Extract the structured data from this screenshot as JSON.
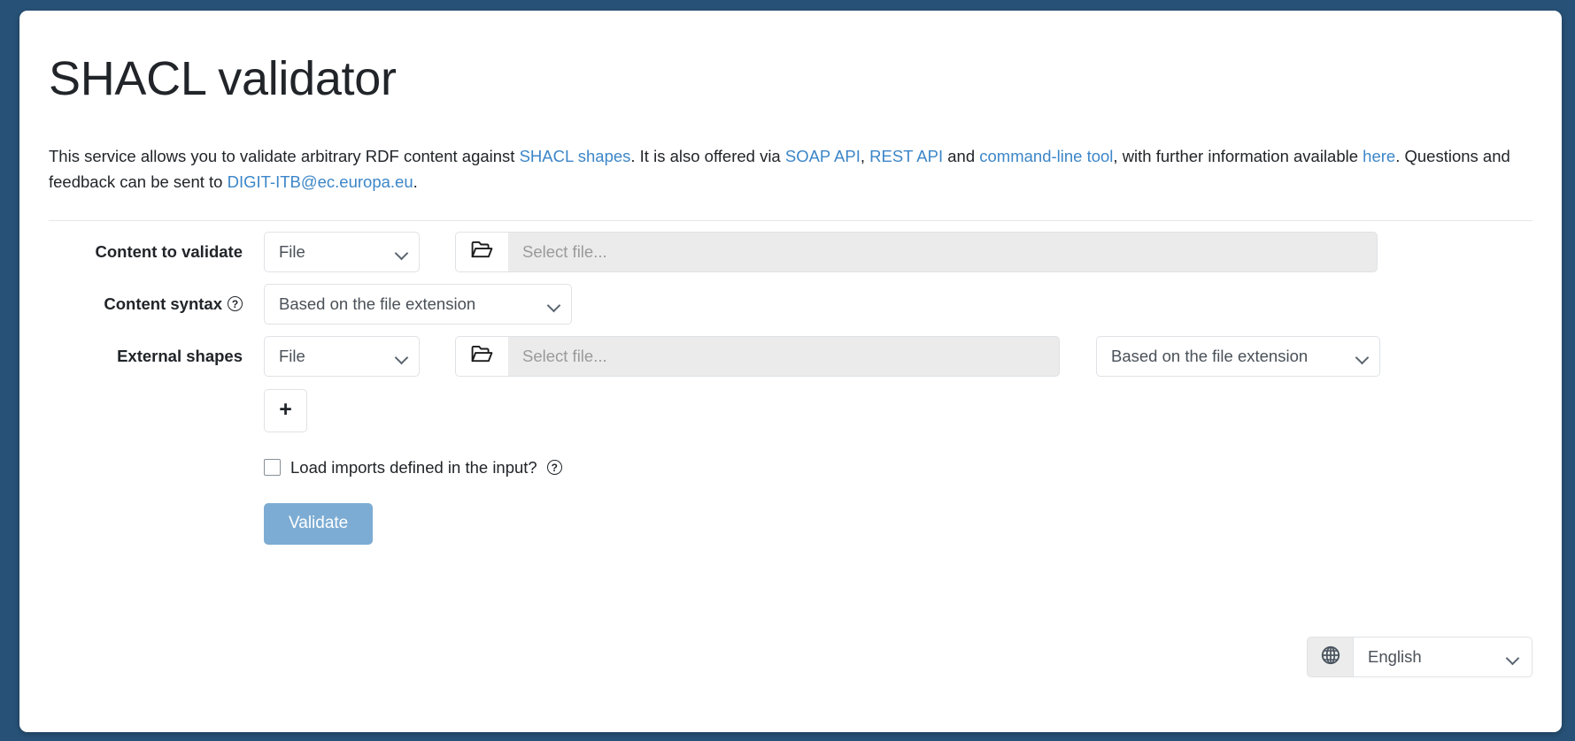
{
  "page": {
    "title": "SHACL validator",
    "background_color": "#275176",
    "card_color": "#ffffff",
    "link_color": "#3c86c8"
  },
  "intro": {
    "part1": "This service allows you to validate arbitrary RDF content against ",
    "link_shacl_shapes": "SHACL shapes",
    "part2": ". It is also offered via ",
    "link_soap_api": "SOAP API",
    "part3": ", ",
    "link_rest_api": "REST API",
    "part4": " and ",
    "link_cli_tool": "command-line tool",
    "part5": ", with further information available ",
    "link_here": "here",
    "part6": ". Questions and feedback can be sent to ",
    "link_email": "DIGIT-ITB@ec.europa.eu",
    "part7": "."
  },
  "form": {
    "content_to_validate": {
      "label": "Content to validate",
      "type_select_value": "File",
      "file_button_icon": "open-folder-icon",
      "file_placeholder": "Select file..."
    },
    "content_syntax": {
      "label": "Content syntax",
      "help_icon": "question-circle-icon",
      "select_value": "Based on the file extension"
    },
    "external_shapes": {
      "label": "External shapes",
      "type_select_value": "File",
      "file_button_icon": "open-folder-icon",
      "file_placeholder": "Select file...",
      "syntax_select_value": "Based on the file extension"
    },
    "add_button_label": "+",
    "load_imports": {
      "label": "Load imports defined in the input?",
      "checked": false,
      "help_icon": "question-circle-icon"
    },
    "validate_button_label": "Validate",
    "validate_button_color": "#7cacd3"
  },
  "language_selector": {
    "icon": "globe-icon",
    "value": "English"
  }
}
